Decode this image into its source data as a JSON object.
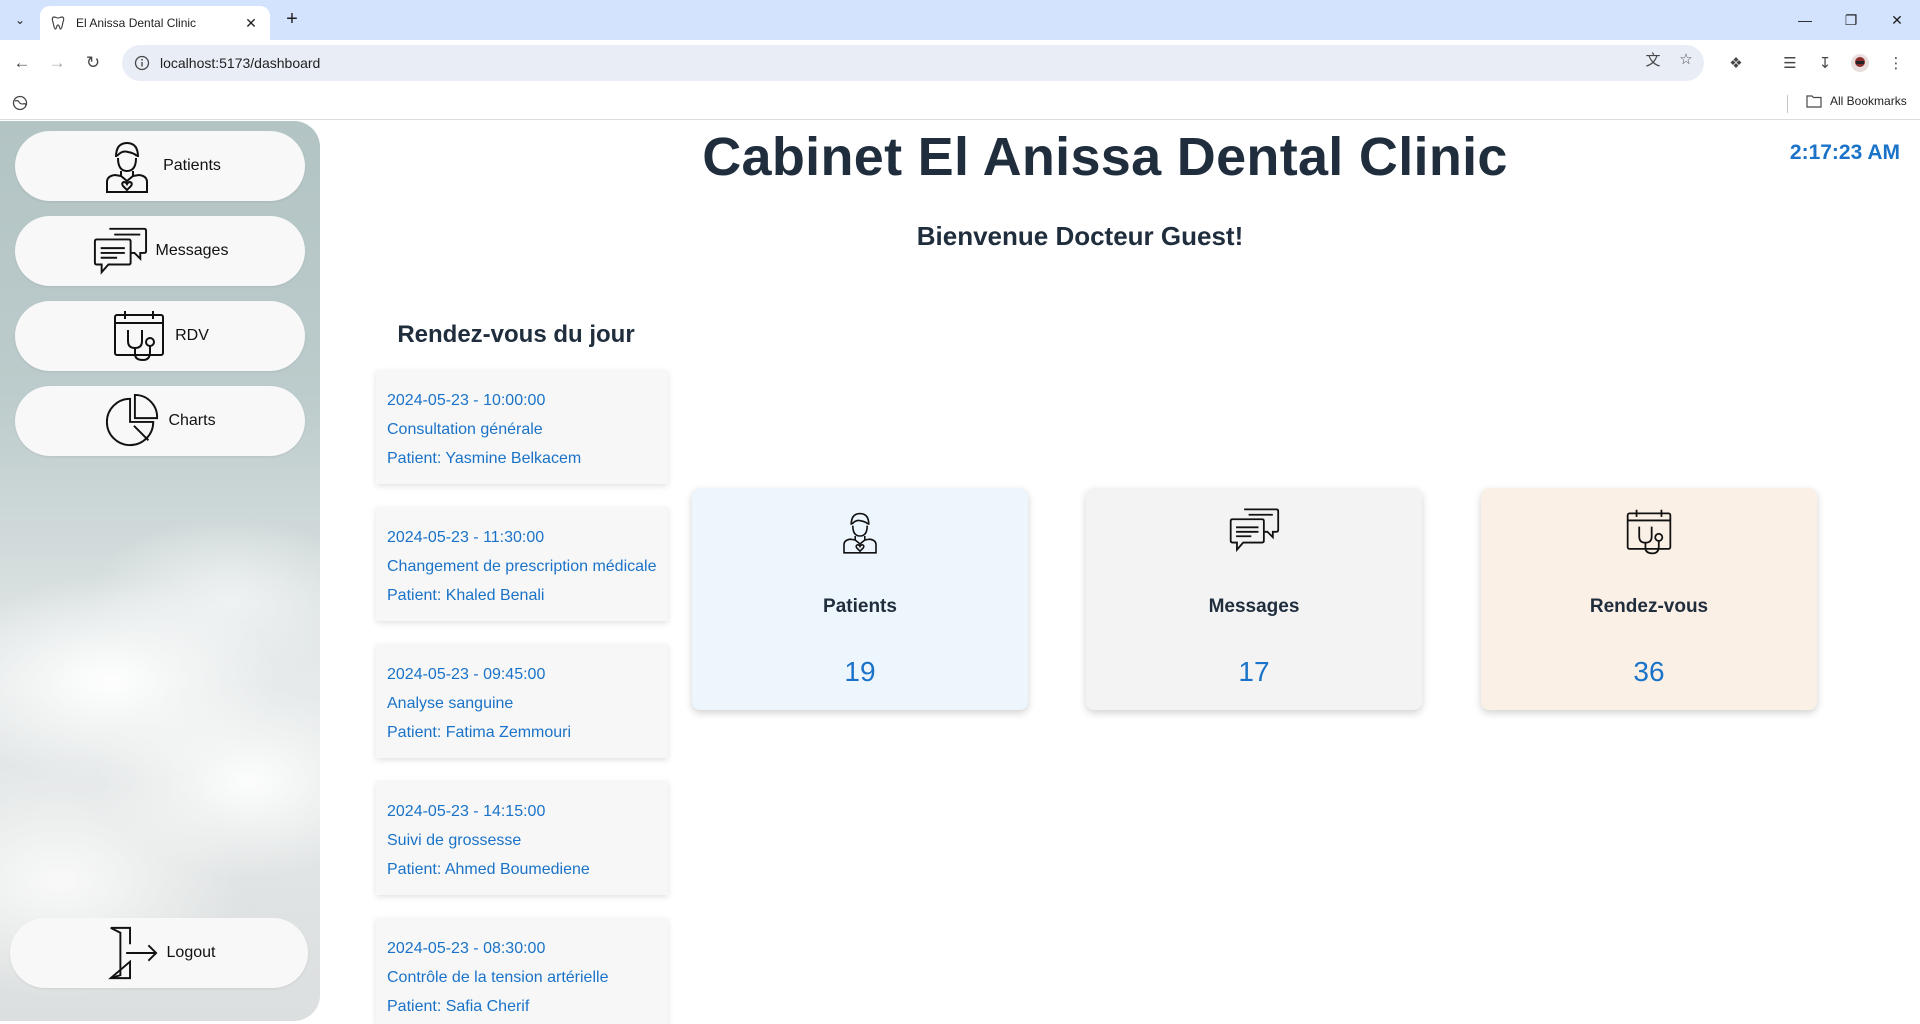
{
  "browser": {
    "tab_title": "El Anissa Dental Clinic",
    "url": "localhost:5173/dashboard",
    "all_bookmarks": "All Bookmarks"
  },
  "app": {
    "title": "Cabinet El Anissa Dental Clinic",
    "clock": "2:17:23 AM",
    "welcome": "Bienvenue Docteur Guest!"
  },
  "sidebar": {
    "items": [
      {
        "label": "Patients",
        "icon": "patient-icon"
      },
      {
        "label": "Messages",
        "icon": "messages-icon"
      },
      {
        "label": "RDV",
        "icon": "calendar-stethoscope-icon"
      },
      {
        "label": "Charts",
        "icon": "pie-chart-icon"
      }
    ],
    "logout": {
      "label": "Logout",
      "icon": "logout-icon"
    }
  },
  "appointments": {
    "title": "Rendez-vous du jour",
    "items": [
      {
        "datetime": "2024-05-23 - 10:00:00",
        "reason": "Consultation générale",
        "patient": "Patient: Yasmine Belkacem"
      },
      {
        "datetime": "2024-05-23 - 11:30:00",
        "reason": "Changement de prescription médicale",
        "patient": "Patient: Khaled Benali"
      },
      {
        "datetime": "2024-05-23 - 09:45:00",
        "reason": "Analyse sanguine",
        "patient": "Patient: Fatima Zemmouri"
      },
      {
        "datetime": "2024-05-23 - 14:15:00",
        "reason": "Suivi de grossesse",
        "patient": "Patient: Ahmed Boumediene"
      },
      {
        "datetime": "2024-05-23 - 08:30:00",
        "reason": "Contrôle de la tension artérielle",
        "patient": "Patient: Safia Cherif"
      }
    ]
  },
  "stats": [
    {
      "label": "Patients",
      "value": "19",
      "bg": "#eef6fd",
      "icon": "patient-icon"
    },
    {
      "label": "Messages",
      "value": "17",
      "bg": "#f3f3f3",
      "icon": "messages-icon"
    },
    {
      "label": "Rendez-vous",
      "value": "36",
      "bg": "#faf0e6",
      "icon": "calendar-stethoscope-icon"
    }
  ],
  "colors": {
    "accent": "#1a73c8",
    "heading": "#1f2d3d",
    "chrome": "#d3e3fd"
  }
}
